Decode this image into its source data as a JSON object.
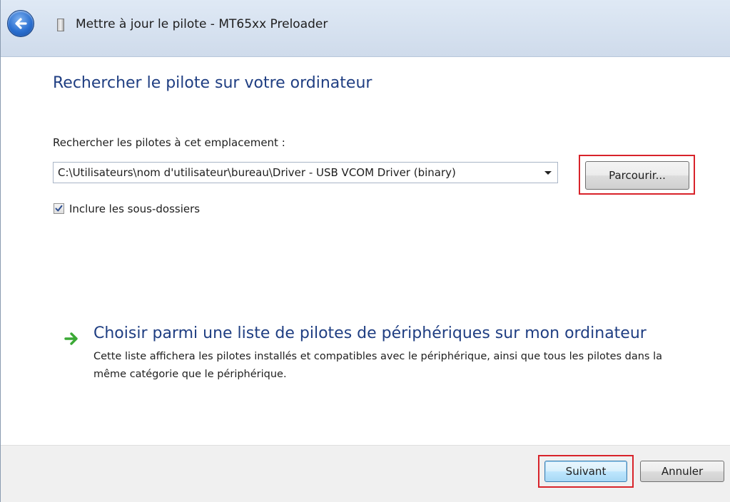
{
  "window": {
    "title": "Mettre à jour le pilote - MT65xx Preloader"
  },
  "icons": {
    "back": "back-arrow-icon",
    "device": "device-icon",
    "combo_arrow": "chevron-down-icon",
    "check": "checkmark-icon",
    "option_arrow": "green-arrow-icon"
  },
  "main": {
    "heading": "Rechercher le pilote sur votre ordinateur",
    "path_label": "Rechercher les pilotes à cet emplacement :",
    "path_value": "C:\\Utilisateurs\\nom d'utilisateur\\bureau\\Driver - USB VCOM Driver (binary)",
    "browse_label": "Parcourir...",
    "include_subfolders_label": "Inclure les sous-dossiers",
    "include_subfolders_checked": true,
    "option_title": "Choisir parmi une liste de pilotes de périphériques sur mon ordinateur",
    "option_description": "Cette liste affichera les pilotes installés et compatibles avec le périphérique, ainsi que tous les pilotes dans la même catégorie que le périphérique."
  },
  "footer": {
    "next_label": "Suivant",
    "cancel_label": "Annuler"
  },
  "colors": {
    "heading": "#1f3e82",
    "highlight": "#d8232a",
    "arrow": "#3aa935"
  }
}
